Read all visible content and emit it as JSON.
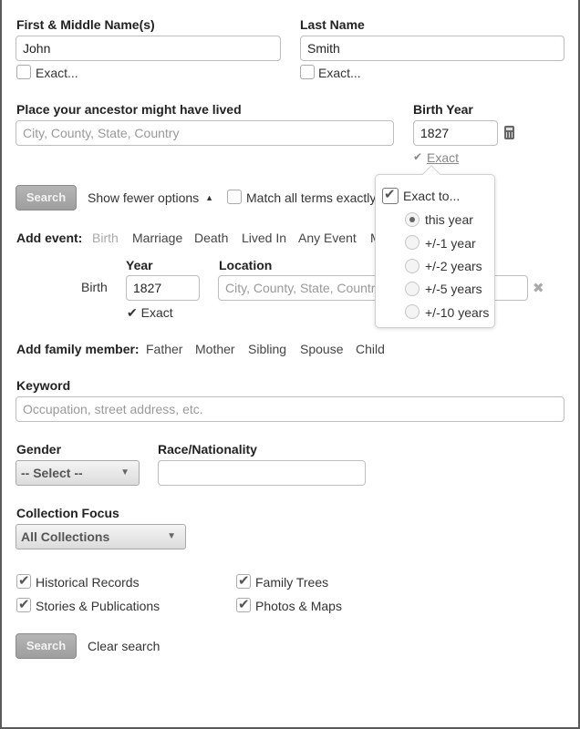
{
  "name": {
    "first_label": "First & Middle Name(s)",
    "first_value": "John",
    "first_exact": "Exact...",
    "last_label": "Last Name",
    "last_value": "Smith",
    "last_exact": "Exact..."
  },
  "place": {
    "label": "Place your ancestor might have lived",
    "placeholder": "City, County, State, Country"
  },
  "birth_year": {
    "label": "Birth Year",
    "value": "1827",
    "exact_link": "Exact",
    "check_glyph": "✔"
  },
  "actions": {
    "search_label": "Search",
    "show_fewer": "Show fewer options",
    "show_fewer_arrow": "▲",
    "match_all": "Match all terms exactly"
  },
  "add_event": {
    "label": "Add event:",
    "items": [
      "Birth",
      "Marriage",
      "Death",
      "Lived In",
      "Any Event",
      "M"
    ]
  },
  "event_row": {
    "event_name": "Birth",
    "year_label": "Year",
    "year_value": "1827",
    "location_label": "Location",
    "location_placeholder": "City, County, State, Country",
    "exact_text": "✔ Exact",
    "remove_glyph": "✖"
  },
  "exact_popup": {
    "title": "Exact to...",
    "options": [
      "this year",
      "+/-1 year",
      "+/-2 years",
      "+/-5 years",
      "+/-10 years"
    ],
    "selected": "this year"
  },
  "family": {
    "label": "Add family member:",
    "items": [
      "Father",
      "Mother",
      "Sibling",
      "Spouse",
      "Child"
    ]
  },
  "keyword": {
    "label": "Keyword",
    "placeholder": "Occupation, street address, etc."
  },
  "gender": {
    "label": "Gender",
    "selected": "-- Select --",
    "arrow": "▼"
  },
  "race": {
    "label": "Race/Nationality",
    "value": ""
  },
  "collection": {
    "label": "Collection Focus",
    "selected": "All Collections",
    "arrow": "▼"
  },
  "content_types": [
    {
      "label": "Historical Records",
      "checked": true
    },
    {
      "label": "Family Trees",
      "checked": true
    },
    {
      "label": "Stories & Publications",
      "checked": true
    },
    {
      "label": "Photos & Maps",
      "checked": true
    }
  ],
  "footer": {
    "search_label": "Search",
    "clear_label": "Clear search"
  }
}
